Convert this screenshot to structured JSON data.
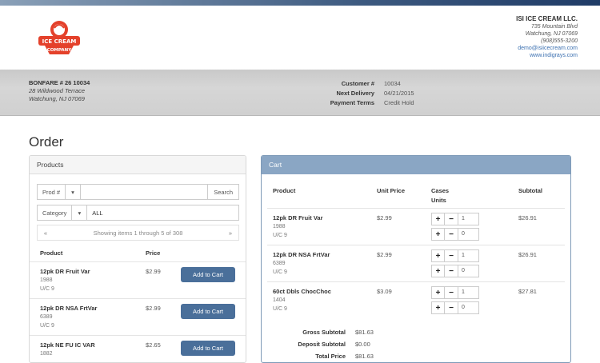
{
  "company": {
    "name": "ISI ICE CREAM LLC.",
    "lines": [
      "735 Mountain Blvd",
      "Watchung, NJ 07069",
      "(908)555-3200"
    ],
    "email": "demo@isiicecream.com",
    "web": "www.indigrays.com",
    "logo_text": [
      "ICE CREAM",
      "COMPANY"
    ]
  },
  "customer": {
    "name": "BONFARE # 26 10034",
    "addr1": "28 Wildwood Terrace",
    "addr2": "Watchung, NJ 07069",
    "fields": [
      {
        "label": "Customer #",
        "value": "10034"
      },
      {
        "label": "Next Delivery",
        "value": "04/21/2015"
      },
      {
        "label": "Payment Terms",
        "value": "Credit Hold"
      }
    ]
  },
  "page_title": "Order",
  "products": {
    "header": "Products",
    "search_field": "Prod #",
    "search_button": "Search",
    "category_field": "Category",
    "category_value": "ALL",
    "pager_prev": "«",
    "pager_text": "Showing items 1 through 5 of 308",
    "pager_next": "»",
    "col_product": "Product",
    "col_price": "Price",
    "add_label": "Add to Cart",
    "rows": [
      {
        "name": "12pk DR Fruit Var",
        "code": "1988",
        "uc": "U/C 9",
        "price": "$2.99"
      },
      {
        "name": "12pk DR NSA FrtVar",
        "code": "6389",
        "uc": "U/C 9",
        "price": "$2.99"
      },
      {
        "name": "12pk NE FU IC VAR",
        "code": "1882",
        "uc": "",
        "price": "$2.65"
      }
    ]
  },
  "cart": {
    "header": "Cart",
    "col_product": "Product",
    "col_unit": "Unit Price",
    "col_cases": "Cases",
    "col_units": "Units",
    "col_subtotal": "Subtotal",
    "rows": [
      {
        "name": "12pk DR Fruit Var",
        "code": "1988",
        "uc": "U/C 9",
        "price": "$2.99",
        "cases": "1",
        "units": "0",
        "subtotal": "$26.91"
      },
      {
        "name": "12pk DR NSA FrtVar",
        "code": "6389",
        "uc": "U/C 9",
        "price": "$2.99",
        "cases": "1",
        "units": "0",
        "subtotal": "$26.91"
      },
      {
        "name": "60ct Dbls ChocChoc",
        "code": "1404",
        "uc": "U/C 9",
        "price": "$3.09",
        "cases": "1",
        "units": "0",
        "subtotal": "$27.81"
      }
    ],
    "gross_label": "Gross Subtotal",
    "gross_value": "$81.63",
    "deposit_label": "Deposit Subtotal",
    "deposit_value": "$0.00",
    "total_label": "Total Price",
    "total_value": "$81.63"
  },
  "colors": {
    "accent": "#4a6f9a",
    "cart_header": "#8aa6c4",
    "logo_red": "#e4412b"
  }
}
